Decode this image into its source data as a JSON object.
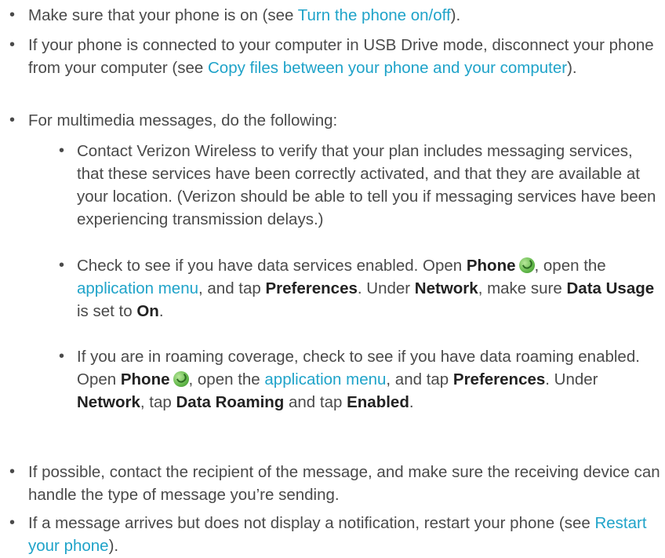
{
  "bullets": [
    {
      "pre": "Make sure that your phone is on (see ",
      "link": "Turn the phone on/off",
      "post": ")."
    },
    {
      "pre": "If your phone is connected to your computer in USB Drive mode, disconnect your phone from your computer (see ",
      "link": "Copy files between your phone and your computer",
      "post": ")."
    },
    {
      "text": "For multimedia messages, do the following:"
    }
  ],
  "sub": {
    "s1": "Contact Verizon Wireless to verify that your plan includes messaging services, that these services have been correctly activated, and that they are available at your location. (Verizon should be able to tell you if messaging services have been experiencing transmission delays.)",
    "s2": {
      "t1": "Check to see if you have data services enabled. Open ",
      "phone": "Phone",
      "t2": ", open the ",
      "app_menu": "application menu",
      "t3": ", and tap ",
      "prefs": "Preferences",
      "t4": ". Under ",
      "network": "Network",
      "t5": ", make sure ",
      "data_usage": "Data Usage",
      "t6": " is set to ",
      "on": "On",
      "t7": "."
    },
    "s3": {
      "t1": "If you are in roaming coverage, check to see if you have data roaming enabled. Open ",
      "phone": "Phone",
      "t2": ", open the ",
      "app_menu": "application menu",
      "t3": ", and tap ",
      "prefs": "Preferences",
      "t4": ". Under ",
      "network": "Network",
      "t5": ", tap ",
      "data_roaming": "Data Roaming",
      "t6": " and tap ",
      "enabled": "Enabled",
      "t7": "."
    }
  },
  "bottom": [
    {
      "text": "If possible, contact the recipient of the message, and make sure the receiving device can handle the type of message you’re sending."
    },
    {
      "pre": "If a message arrives but does not display a notification, restart your phone (see ",
      "link": "Restart your phone",
      "post": ")."
    }
  ],
  "icons": {
    "phone": "phone-app-icon"
  },
  "colors": {
    "link": "#1fa3c9",
    "text": "#4a4a4a"
  }
}
